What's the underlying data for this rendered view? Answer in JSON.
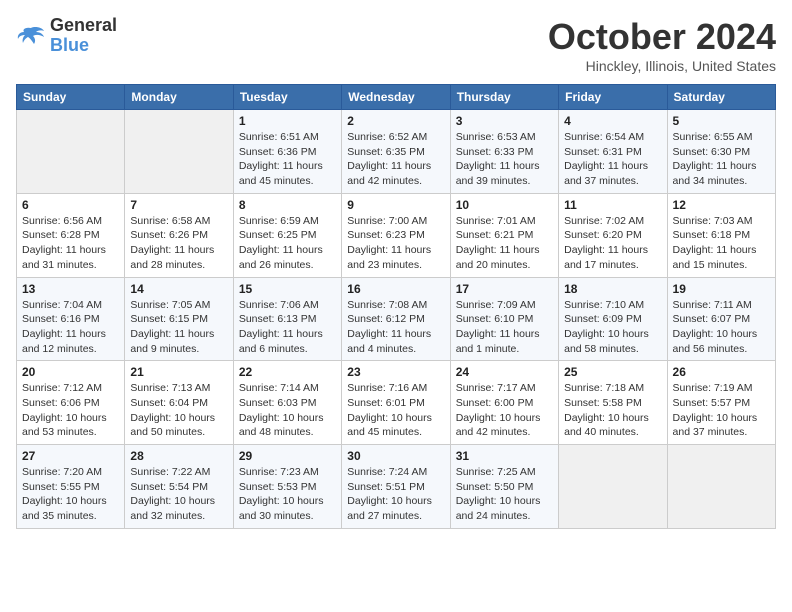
{
  "header": {
    "logo_line1": "General",
    "logo_line2": "Blue",
    "month_title": "October 2024",
    "location": "Hinckley, Illinois, United States"
  },
  "weekdays": [
    "Sunday",
    "Monday",
    "Tuesday",
    "Wednesday",
    "Thursday",
    "Friday",
    "Saturday"
  ],
  "weeks": [
    [
      {
        "day": "",
        "info": ""
      },
      {
        "day": "",
        "info": ""
      },
      {
        "day": "1",
        "info": "Sunrise: 6:51 AM\nSunset: 6:36 PM\nDaylight: 11 hours and 45 minutes."
      },
      {
        "day": "2",
        "info": "Sunrise: 6:52 AM\nSunset: 6:35 PM\nDaylight: 11 hours and 42 minutes."
      },
      {
        "day": "3",
        "info": "Sunrise: 6:53 AM\nSunset: 6:33 PM\nDaylight: 11 hours and 39 minutes."
      },
      {
        "day": "4",
        "info": "Sunrise: 6:54 AM\nSunset: 6:31 PM\nDaylight: 11 hours and 37 minutes."
      },
      {
        "day": "5",
        "info": "Sunrise: 6:55 AM\nSunset: 6:30 PM\nDaylight: 11 hours and 34 minutes."
      }
    ],
    [
      {
        "day": "6",
        "info": "Sunrise: 6:56 AM\nSunset: 6:28 PM\nDaylight: 11 hours and 31 minutes."
      },
      {
        "day": "7",
        "info": "Sunrise: 6:58 AM\nSunset: 6:26 PM\nDaylight: 11 hours and 28 minutes."
      },
      {
        "day": "8",
        "info": "Sunrise: 6:59 AM\nSunset: 6:25 PM\nDaylight: 11 hours and 26 minutes."
      },
      {
        "day": "9",
        "info": "Sunrise: 7:00 AM\nSunset: 6:23 PM\nDaylight: 11 hours and 23 minutes."
      },
      {
        "day": "10",
        "info": "Sunrise: 7:01 AM\nSunset: 6:21 PM\nDaylight: 11 hours and 20 minutes."
      },
      {
        "day": "11",
        "info": "Sunrise: 7:02 AM\nSunset: 6:20 PM\nDaylight: 11 hours and 17 minutes."
      },
      {
        "day": "12",
        "info": "Sunrise: 7:03 AM\nSunset: 6:18 PM\nDaylight: 11 hours and 15 minutes."
      }
    ],
    [
      {
        "day": "13",
        "info": "Sunrise: 7:04 AM\nSunset: 6:16 PM\nDaylight: 11 hours and 12 minutes."
      },
      {
        "day": "14",
        "info": "Sunrise: 7:05 AM\nSunset: 6:15 PM\nDaylight: 11 hours and 9 minutes."
      },
      {
        "day": "15",
        "info": "Sunrise: 7:06 AM\nSunset: 6:13 PM\nDaylight: 11 hours and 6 minutes."
      },
      {
        "day": "16",
        "info": "Sunrise: 7:08 AM\nSunset: 6:12 PM\nDaylight: 11 hours and 4 minutes."
      },
      {
        "day": "17",
        "info": "Sunrise: 7:09 AM\nSunset: 6:10 PM\nDaylight: 11 hours and 1 minute."
      },
      {
        "day": "18",
        "info": "Sunrise: 7:10 AM\nSunset: 6:09 PM\nDaylight: 10 hours and 58 minutes."
      },
      {
        "day": "19",
        "info": "Sunrise: 7:11 AM\nSunset: 6:07 PM\nDaylight: 10 hours and 56 minutes."
      }
    ],
    [
      {
        "day": "20",
        "info": "Sunrise: 7:12 AM\nSunset: 6:06 PM\nDaylight: 10 hours and 53 minutes."
      },
      {
        "day": "21",
        "info": "Sunrise: 7:13 AM\nSunset: 6:04 PM\nDaylight: 10 hours and 50 minutes."
      },
      {
        "day": "22",
        "info": "Sunrise: 7:14 AM\nSunset: 6:03 PM\nDaylight: 10 hours and 48 minutes."
      },
      {
        "day": "23",
        "info": "Sunrise: 7:16 AM\nSunset: 6:01 PM\nDaylight: 10 hours and 45 minutes."
      },
      {
        "day": "24",
        "info": "Sunrise: 7:17 AM\nSunset: 6:00 PM\nDaylight: 10 hours and 42 minutes."
      },
      {
        "day": "25",
        "info": "Sunrise: 7:18 AM\nSunset: 5:58 PM\nDaylight: 10 hours and 40 minutes."
      },
      {
        "day": "26",
        "info": "Sunrise: 7:19 AM\nSunset: 5:57 PM\nDaylight: 10 hours and 37 minutes."
      }
    ],
    [
      {
        "day": "27",
        "info": "Sunrise: 7:20 AM\nSunset: 5:55 PM\nDaylight: 10 hours and 35 minutes."
      },
      {
        "day": "28",
        "info": "Sunrise: 7:22 AM\nSunset: 5:54 PM\nDaylight: 10 hours and 32 minutes."
      },
      {
        "day": "29",
        "info": "Sunrise: 7:23 AM\nSunset: 5:53 PM\nDaylight: 10 hours and 30 minutes."
      },
      {
        "day": "30",
        "info": "Sunrise: 7:24 AM\nSunset: 5:51 PM\nDaylight: 10 hours and 27 minutes."
      },
      {
        "day": "31",
        "info": "Sunrise: 7:25 AM\nSunset: 5:50 PM\nDaylight: 10 hours and 24 minutes."
      },
      {
        "day": "",
        "info": ""
      },
      {
        "day": "",
        "info": ""
      }
    ]
  ]
}
